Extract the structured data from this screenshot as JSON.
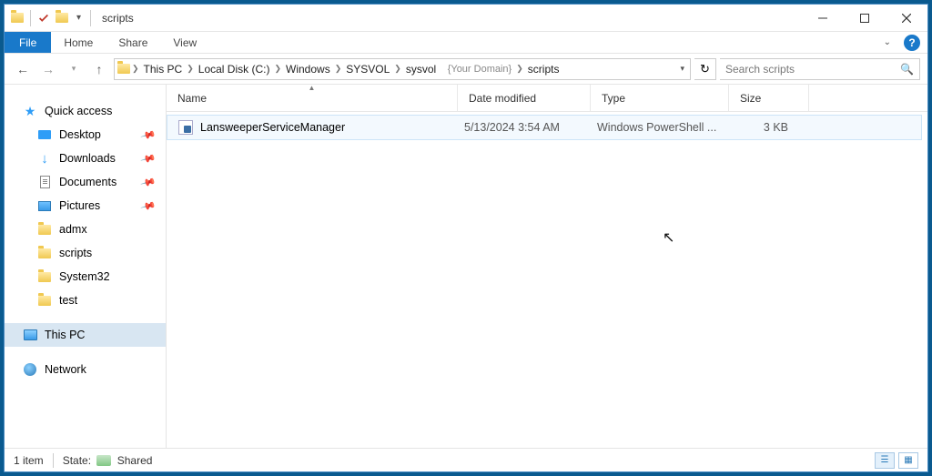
{
  "window": {
    "title": "scripts"
  },
  "ribbon": {
    "file": "File",
    "tabs": [
      "Home",
      "Share",
      "View"
    ]
  },
  "nav": {
    "breadcrumb": [
      "This PC",
      "Local Disk (C:)",
      "Windows",
      "SYSVOL",
      "sysvol",
      "scripts"
    ],
    "domain_placeholder": "{Your Domain}",
    "search_placeholder": "Search scripts"
  },
  "sidebar": {
    "quick_access": "Quick access",
    "pinned": [
      {
        "label": "Desktop",
        "pinned": true
      },
      {
        "label": "Downloads",
        "pinned": true
      },
      {
        "label": "Documents",
        "pinned": true
      },
      {
        "label": "Pictures",
        "pinned": true
      }
    ],
    "folders": [
      "admx",
      "scripts",
      "System32",
      "test"
    ],
    "this_pc": "This PC",
    "network": "Network"
  },
  "columns": {
    "name": "Name",
    "date": "Date modified",
    "type": "Type",
    "size": "Size"
  },
  "files": [
    {
      "name": "LansweeperServiceManager",
      "date": "5/13/2024 3:54 AM",
      "type": "Windows PowerShell ...",
      "size": "3 KB"
    }
  ],
  "status": {
    "count": "1 item",
    "state_label": "State:",
    "state_value": "Shared"
  }
}
